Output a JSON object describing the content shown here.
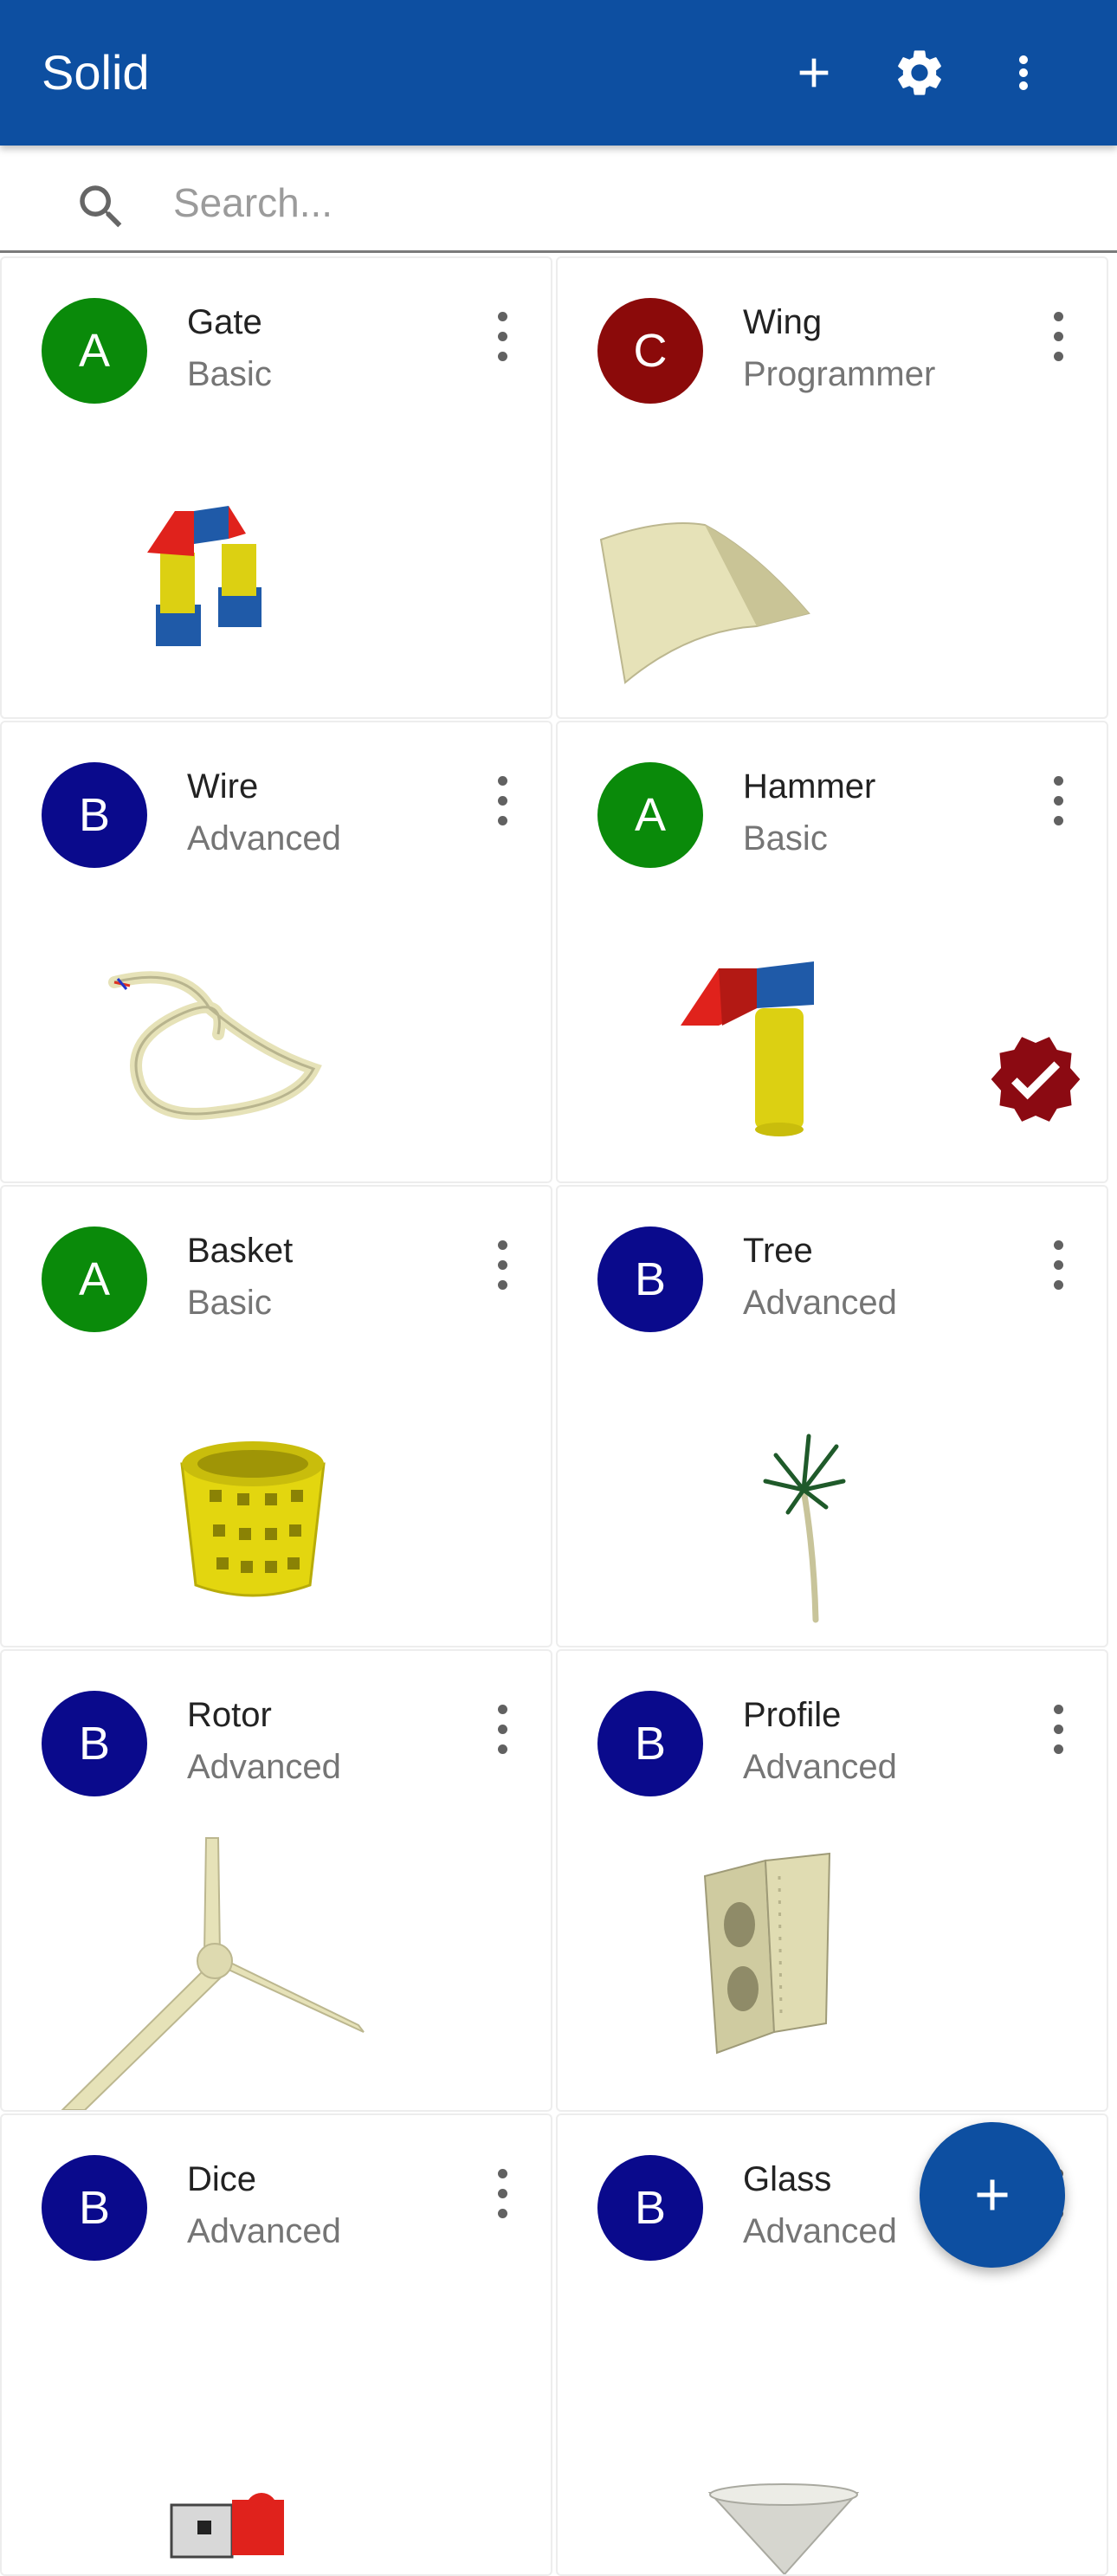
{
  "app": {
    "title": "Solid"
  },
  "toolbar": {
    "add_icon": "plus-icon",
    "settings_icon": "gear-icon",
    "more_icon": "more-vert-icon"
  },
  "search": {
    "placeholder": "Search...",
    "value": ""
  },
  "colors": {
    "appbar": "#0d4fa1",
    "avatar_A": "#0a8a0a",
    "avatar_B": "#0a0a8c",
    "avatar_C": "#8b0a0a",
    "badge": "#8b0a12"
  },
  "items": [
    {
      "avatar": "A",
      "name": "Gate",
      "level": "Basic",
      "thumbnail": "gate"
    },
    {
      "avatar": "C",
      "name": "Wing",
      "level": "Programmer",
      "thumbnail": "wing"
    },
    {
      "avatar": "B",
      "name": "Wire",
      "level": "Advanced",
      "thumbnail": "wire"
    },
    {
      "avatar": "A",
      "name": "Hammer",
      "level": "Basic",
      "thumbnail": "hammer",
      "badge": "verified-badge-icon"
    },
    {
      "avatar": "A",
      "name": "Basket",
      "level": "Basic",
      "thumbnail": "basket"
    },
    {
      "avatar": "B",
      "name": "Tree",
      "level": "Advanced",
      "thumbnail": "tree"
    },
    {
      "avatar": "B",
      "name": "Rotor",
      "level": "Advanced",
      "thumbnail": "rotor"
    },
    {
      "avatar": "B",
      "name": "Profile",
      "level": "Advanced",
      "thumbnail": "profile"
    },
    {
      "avatar": "B",
      "name": "Dice",
      "level": "Advanced",
      "thumbnail": "dice"
    },
    {
      "avatar": "B",
      "name": "Glass",
      "level": "Advanced",
      "thumbnail": "glass"
    }
  ],
  "fab": {
    "icon": "plus-icon"
  }
}
